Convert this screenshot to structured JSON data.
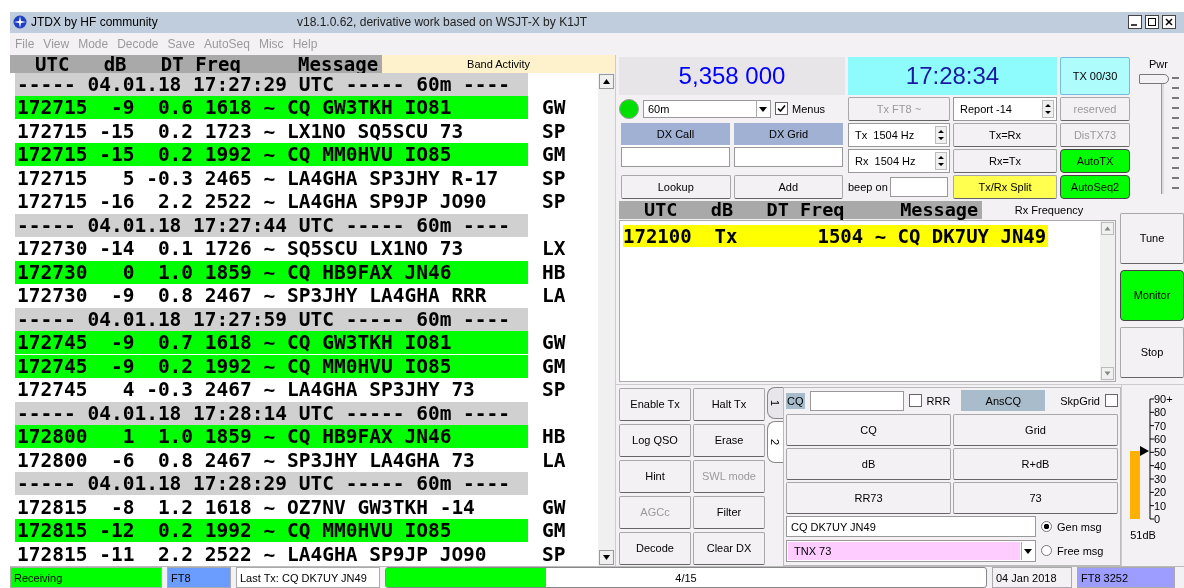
{
  "window": {
    "title": "JTDX  by HF community",
    "subtitle": "v18.1.0.62, derivative work based on WSJT-X by K1JT"
  },
  "menu": [
    "File",
    "View",
    "Mode",
    "Decode",
    "Save",
    "AutoSeq",
    "Misc",
    "Help"
  ],
  "band_activity": {
    "header": "UTC   dB   DT Freq     Message",
    "title": "Band Activity",
    "rows": [
      {
        "kind": "separator",
        "text": "----- 04.01.18 17:27:29 UTC ----- 60m ----"
      },
      {
        "kind": "cq",
        "text": "172715  -9  0.6 1618 ~ CQ GW3TKH IO81",
        "country": "GW"
      },
      {
        "kind": "plain",
        "text": "172715 -15  0.2 1723 ~ LX1NO SQ5SCU 73",
        "country": "SP"
      },
      {
        "kind": "cq",
        "text": "172715 -15  0.2 1992 ~ CQ MM0HVU IO85",
        "country": "GM"
      },
      {
        "kind": "plain",
        "text": "172715   5 -0.3 2465 ~ LA4GHA SP3JHY R-17",
        "country": "SP"
      },
      {
        "kind": "plain",
        "text": "172715 -16  2.2 2522 ~ LA4GHA SP9JP JO90",
        "country": "SP"
      },
      {
        "kind": "separator",
        "text": "----- 04.01.18 17:27:44 UTC ----- 60m ----"
      },
      {
        "kind": "plain",
        "text": "172730 -14  0.1 1726 ~ SQ5SCU LX1NO 73",
        "country": "LX"
      },
      {
        "kind": "cq",
        "text": "172730   0  1.0 1859 ~ CQ HB9FAX JN46",
        "country": "HB"
      },
      {
        "kind": "plain",
        "text": "172730  -9  0.8 2467 ~ SP3JHY LA4GHA RRR",
        "country": "LA"
      },
      {
        "kind": "separator",
        "text": "----- 04.01.18 17:27:59 UTC ----- 60m ----"
      },
      {
        "kind": "cq",
        "text": "172745  -9  0.7 1618 ~ CQ GW3TKH IO81",
        "country": "GW"
      },
      {
        "kind": "cq",
        "text": "172745  -9  0.2 1992 ~ CQ MM0HVU IO85",
        "country": "GM"
      },
      {
        "kind": "plain",
        "text": "172745   4 -0.3 2467 ~ LA4GHA SP3JHY 73",
        "country": "SP"
      },
      {
        "kind": "separator",
        "text": "----- 04.01.18 17:28:14 UTC ----- 60m ----"
      },
      {
        "kind": "cq",
        "text": "172800   1  1.0 1859 ~ CQ HB9FAX JN46",
        "country": "HB"
      },
      {
        "kind": "plain",
        "text": "172800  -6  0.8 2467 ~ SP3JHY LA4GHA 73",
        "country": "LA"
      },
      {
        "kind": "separator",
        "text": "----- 04.01.18 17:28:29 UTC ----- 60m ----"
      },
      {
        "kind": "plain",
        "text": "172815  -8  1.2 1618 ~ OZ7NV GW3TKH -14",
        "country": "GW"
      },
      {
        "kind": "cq",
        "text": "172815 -12  0.2 1992 ~ CQ MM0HVU IO85",
        "country": "GM"
      },
      {
        "kind": "plain",
        "text": "172815 -11  2.2 2522 ~ LA4GHA SP9JP JO90",
        "country": "SP"
      }
    ]
  },
  "frequency": "5,358 000",
  "clock": "17:28:34",
  "tx_counter": "TX 00/30",
  "monitor_led": {
    "on": true
  },
  "band": {
    "value": "60m"
  },
  "menus_checkbox": {
    "label": "Menus",
    "checked": true
  },
  "dx_call": {
    "label": "DX Call"
  },
  "dx_grid": {
    "label": "DX Grid"
  },
  "lookup_buttons": [
    "Lookup",
    "Add"
  ],
  "mode_button": {
    "label": "Tx FT8 ~",
    "disabled": true
  },
  "tx_freq": {
    "label": "Tx",
    "value": "1504 Hz"
  },
  "rx_freq": {
    "label": "Rx",
    "value": "1504 Hz"
  },
  "beep": {
    "label": "beep on"
  },
  "report": {
    "value": "Report -14"
  },
  "mid_buttons": [
    {
      "label": "Tx=Rx",
      "on": false
    },
    {
      "label": "Rx=Tx",
      "on": false
    },
    {
      "label": "Tx/Rx Split",
      "on": true
    }
  ],
  "auto_buttons": [
    {
      "label": "reserved",
      "disabled": true,
      "on": false
    },
    {
      "label": "DisTX73",
      "disabled": true,
      "on": false
    },
    {
      "label": "AutoTX",
      "disabled": false,
      "on": true
    },
    {
      "label": "AutoSeq2",
      "disabled": false,
      "on": true
    }
  ],
  "power": {
    "label": "Pwr",
    "level": 1
  },
  "rx_frequency": {
    "header": "UTC   dB   DT Freq     Message",
    "title": "Rx Frequency",
    "rows": [
      {
        "kind": "tx",
        "text": "172100  Tx       1504 ~ CQ DK7UY JN49"
      }
    ]
  },
  "side_buttons": [
    {
      "label": "Tune",
      "on": false
    },
    {
      "label": "Monitor",
      "on": true
    },
    {
      "label": "Stop",
      "on": false
    }
  ],
  "action_buttons": [
    {
      "label": "Enable Tx",
      "disabled": false
    },
    {
      "label": "Halt Tx",
      "disabled": false
    },
    {
      "label": "Log QSO",
      "disabled": false
    },
    {
      "label": "Erase",
      "disabled": false
    },
    {
      "label": "Hint",
      "disabled": false
    },
    {
      "label": "SWL mode",
      "disabled": true
    },
    {
      "label": "AGCc",
      "disabled": true
    },
    {
      "label": "Filter",
      "disabled": false
    },
    {
      "label": "Decode",
      "disabled": false
    },
    {
      "label": "Clear DX",
      "disabled": false
    }
  ],
  "tabs": [
    {
      "label": "1",
      "selected": false
    },
    {
      "label": "2",
      "selected": true
    }
  ],
  "cq_row": {
    "prefix": "CQ",
    "rrr": {
      "label": "RRR",
      "checked": false
    },
    "anscq": "AnsCQ",
    "skpgrid": {
      "label": "SkpGrid",
      "checked": false
    }
  },
  "message_buttons": [
    "CQ",
    "Grid",
    "dB",
    "R+dB",
    "RR73",
    "73"
  ],
  "gen_msg": {
    "value": "CQ DK7UY JN49",
    "label": "Gen msg",
    "selected": true
  },
  "free_msg": {
    "value": "TNX 73",
    "label": "Free msg",
    "selected": false
  },
  "meter": {
    "ticks": [
      "90+",
      "80",
      "70",
      "60",
      "50",
      "40",
      "30",
      "20",
      "10",
      "0"
    ],
    "level": 0.567,
    "reading": "51dB"
  },
  "status_bar": {
    "state": "Receiving",
    "mode": "FT8",
    "last_tx": "Last Tx: CQ DK7UY JN49",
    "progress": {
      "level": 0.267,
      "text": "4/15"
    },
    "date": "04 Jan 2018",
    "info": "FT8  3252"
  }
}
